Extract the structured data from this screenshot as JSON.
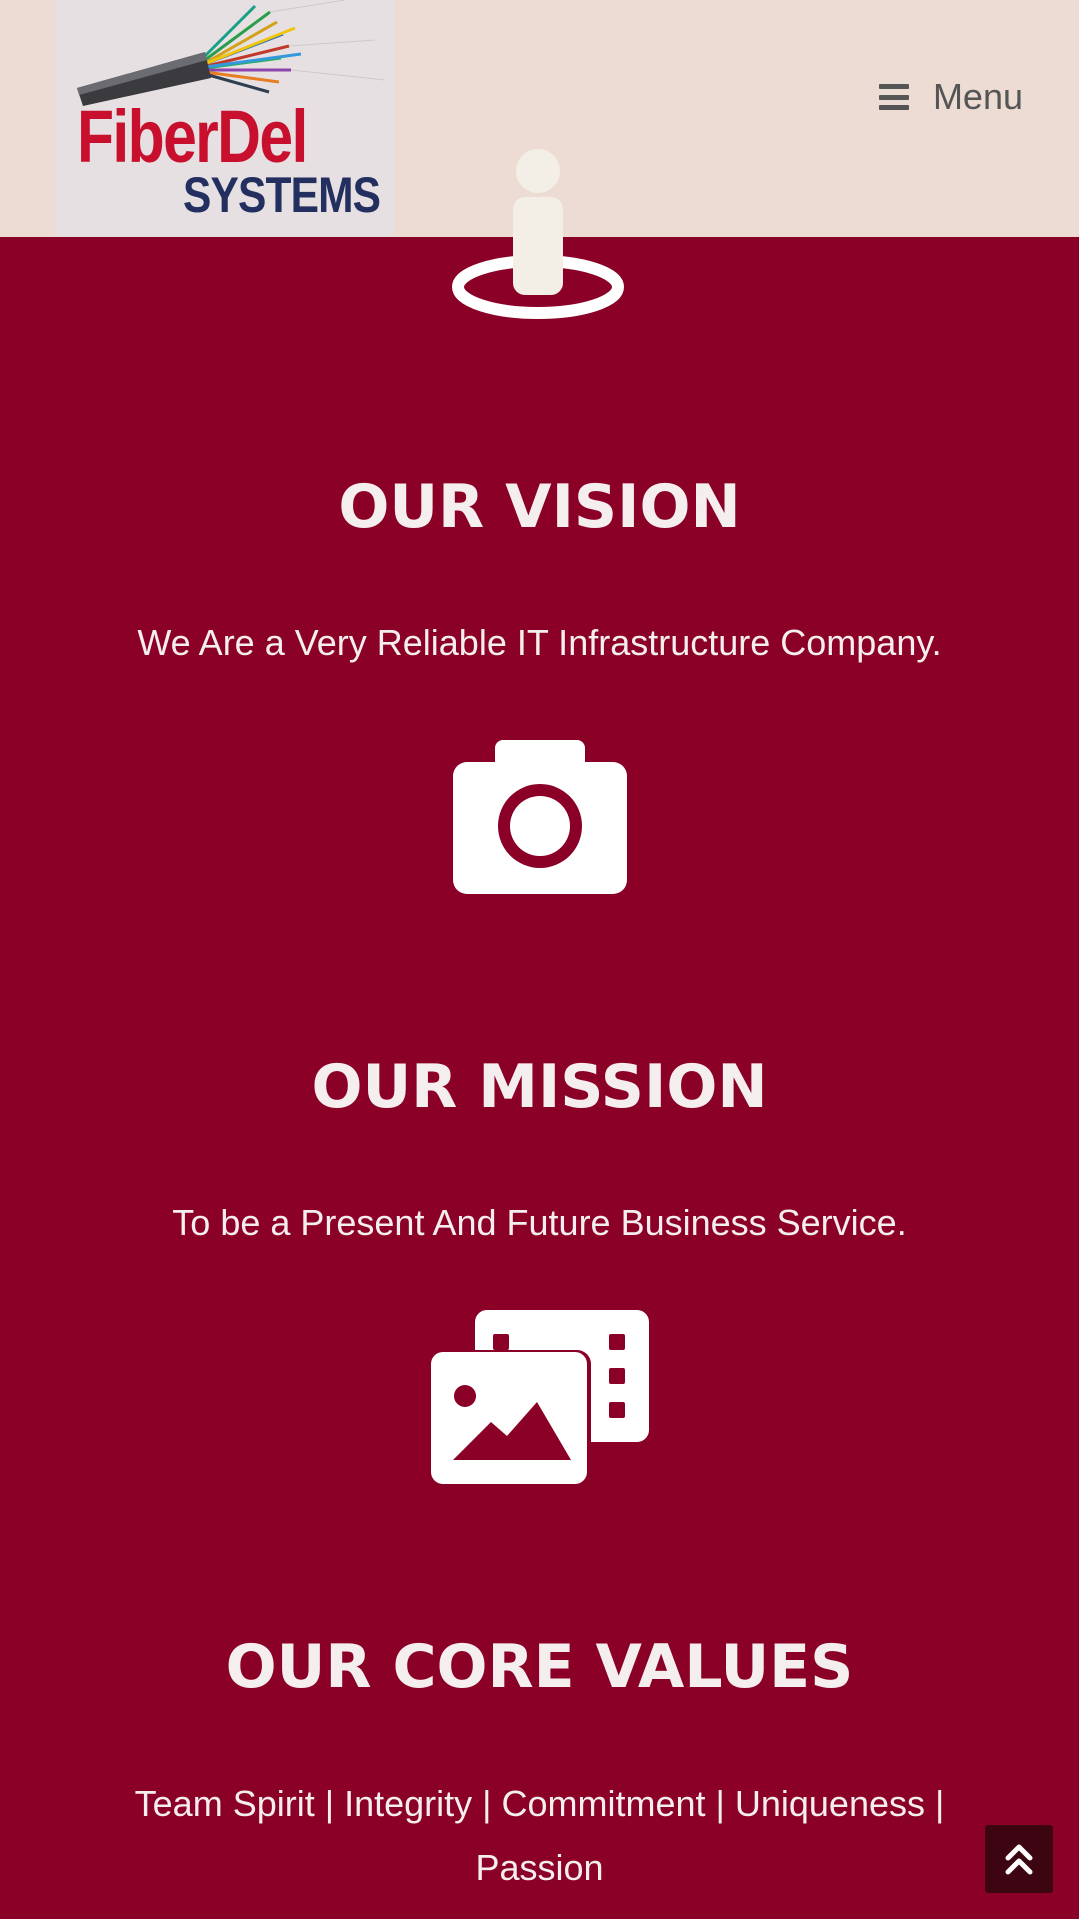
{
  "header": {
    "logo": {
      "name": "FiberDel",
      "subtitle": "SYSTEMS"
    },
    "menu_label": "Menu"
  },
  "sections": [
    {
      "icon": "person-pin-icon",
      "title": "OUR VISION",
      "text": "We Are a Very Reliable IT Infrastructure Company."
    },
    {
      "icon": "camera-icon",
      "title": "OUR MISSION",
      "text": "To be a Present And Future Business Service."
    },
    {
      "icon": "photo-film-icon",
      "title": "OUR CORE VALUES",
      "text": "Team Spirit | Integrity | Commitment | Uniqueness | Passion"
    }
  ],
  "scroll_top": {
    "icon": "double-chevron-up-icon"
  },
  "colors": {
    "background": "#8b0026",
    "header_bg": "#ecdcd3",
    "logo_red": "#c8102e",
    "logo_navy": "#23305f",
    "text_light": "#f5eeee",
    "scroll_button": "#3d0412"
  }
}
